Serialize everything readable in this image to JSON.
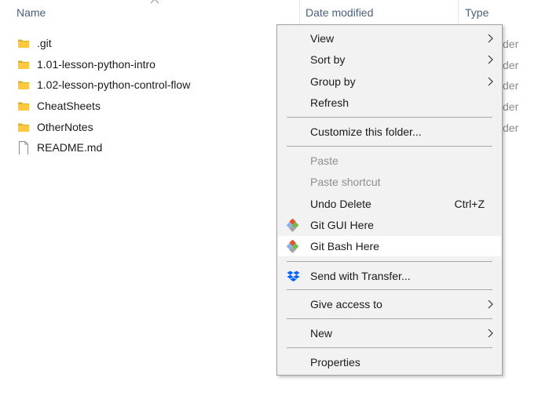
{
  "header": {
    "columns": [
      "Name",
      "Date modified",
      "Type"
    ]
  },
  "files": [
    {
      "name": ".git",
      "icon": "folder-icon",
      "type_partial": "der"
    },
    {
      "name": "1.01-lesson-python-intro",
      "icon": "folder-icon",
      "type_partial": "der"
    },
    {
      "name": "1.02-lesson-python-control-flow",
      "icon": "folder-icon",
      "type_partial": "der"
    },
    {
      "name": "CheatSheets",
      "icon": "folder-icon",
      "type_partial": "der"
    },
    {
      "name": "OtherNotes",
      "icon": "folder-icon",
      "type_partial": "der"
    },
    {
      "name": "README.md",
      "icon": "document-icon",
      "type_partial": ""
    }
  ],
  "context_menu": {
    "items": [
      {
        "label": "View",
        "submenu": true
      },
      {
        "label": "Sort by",
        "submenu": true
      },
      {
        "label": "Group by",
        "submenu": true
      },
      {
        "label": "Refresh"
      },
      {
        "label": "Customize this folder..."
      },
      {
        "label": "Paste",
        "disabled": true
      },
      {
        "label": "Paste shortcut",
        "disabled": true
      },
      {
        "label": "Undo Delete",
        "shortcut": "Ctrl+Z"
      },
      {
        "label": "Git GUI Here",
        "icon": "git-icon"
      },
      {
        "label": "Git Bash Here",
        "icon": "git-icon",
        "highlighted": true
      },
      {
        "label": "Send with Transfer...",
        "icon": "dropbox-icon"
      },
      {
        "label": "Give access to",
        "submenu": true
      },
      {
        "label": "New",
        "submenu": true
      },
      {
        "label": "Properties"
      }
    ]
  },
  "colors": {
    "folder": "#ffc83d",
    "highlight": "#ffffff",
    "menu_bg": "#f2f2f2",
    "header_text": "#4c607a",
    "dropbox": "#0061fe"
  }
}
